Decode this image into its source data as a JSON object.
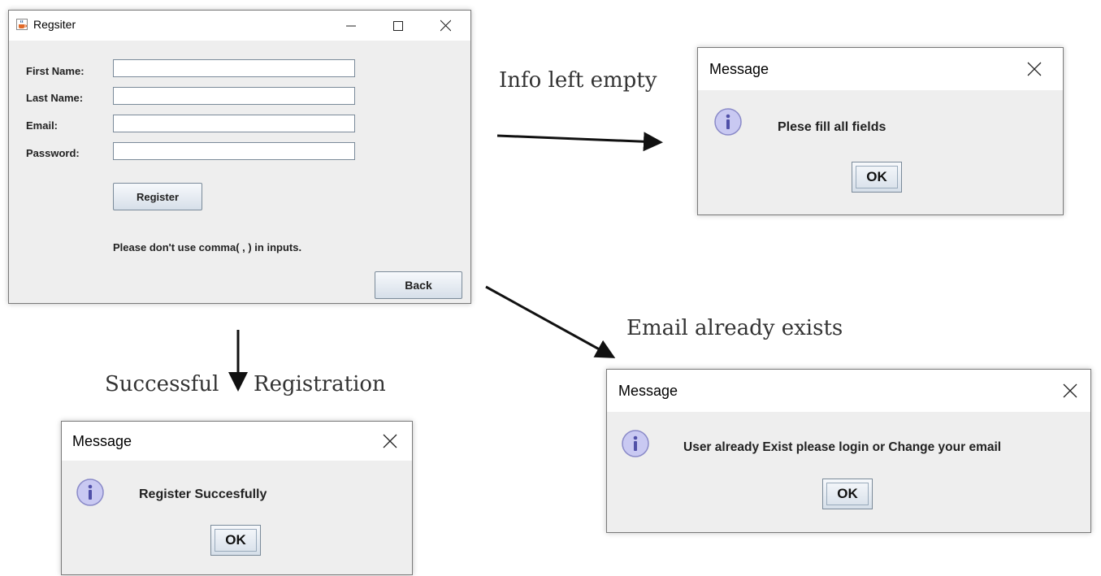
{
  "register_window": {
    "title": "Regsiter",
    "fields": [
      {
        "label": "First Name:",
        "value": ""
      },
      {
        "label": "Last Name:",
        "value": ""
      },
      {
        "label": "Email:",
        "value": ""
      },
      {
        "label": "Password:",
        "value": ""
      }
    ],
    "register_label": "Register",
    "note": "Please don't use comma( , ) in inputs.",
    "back_label": "Back",
    "icon": "java-cup-icon"
  },
  "captions": {
    "empty": "Info left empty",
    "exists": "Email already exists",
    "success_left": "Successful",
    "success_right": "Registration"
  },
  "dialogs": {
    "empty": {
      "title": "Message",
      "message": "Plese fill all fields",
      "ok": "OK",
      "icon": "info-icon"
    },
    "exists": {
      "title": "Message",
      "message": "User already Exist please login or Change your email",
      "ok": "OK",
      "icon": "info-icon"
    },
    "success": {
      "title": "Message",
      "message": "Register Succesfully",
      "ok": "OK",
      "icon": "info-icon"
    }
  },
  "colors": {
    "dialog_bg": "#eeeeee",
    "titlebar_bg": "#ffffff",
    "info_icon": "#c9c9f2"
  }
}
